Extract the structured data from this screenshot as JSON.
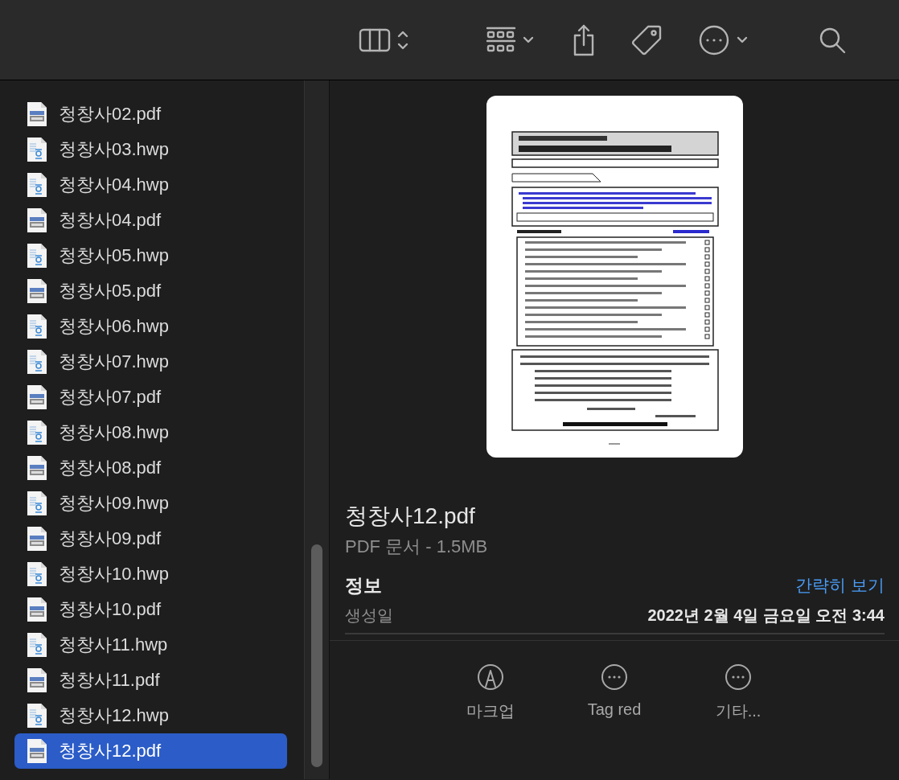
{
  "toolbar": {
    "items": [
      {
        "kind": "columns"
      },
      {
        "kind": "group"
      },
      {
        "kind": "share"
      },
      {
        "kind": "tag"
      },
      {
        "kind": "more"
      },
      {
        "kind": "search"
      }
    ]
  },
  "files": [
    {
      "name": "청창사02.pdf",
      "kind": "pdf",
      "selected": false
    },
    {
      "name": "청창사03.hwp",
      "kind": "hwp",
      "selected": false
    },
    {
      "name": "청창사04.hwp",
      "kind": "hwp",
      "selected": false
    },
    {
      "name": "청창사04.pdf",
      "kind": "pdf",
      "selected": false
    },
    {
      "name": "청창사05.hwp",
      "kind": "hwp",
      "selected": false
    },
    {
      "name": "청창사05.pdf",
      "kind": "pdf",
      "selected": false
    },
    {
      "name": "청창사06.hwp",
      "kind": "hwp",
      "selected": false
    },
    {
      "name": "청창사07.hwp",
      "kind": "hwp",
      "selected": false
    },
    {
      "name": "청창사07.pdf",
      "kind": "pdf",
      "selected": false
    },
    {
      "name": "청창사08.hwp",
      "kind": "hwp",
      "selected": false
    },
    {
      "name": "청창사08.pdf",
      "kind": "pdf",
      "selected": false
    },
    {
      "name": "청창사09.hwp",
      "kind": "hwp",
      "selected": false
    },
    {
      "name": "청창사09.pdf",
      "kind": "pdf",
      "selected": false
    },
    {
      "name": "청창사10.hwp",
      "kind": "hwp",
      "selected": false
    },
    {
      "name": "청창사10.pdf",
      "kind": "pdf",
      "selected": false
    },
    {
      "name": "청창사11.hwp",
      "kind": "hwp",
      "selected": false
    },
    {
      "name": "청창사11.pdf",
      "kind": "pdf",
      "selected": false
    },
    {
      "name": "청창사12.hwp",
      "kind": "hwp",
      "selected": false
    },
    {
      "name": "청창사12.pdf",
      "kind": "pdf",
      "selected": true
    }
  ],
  "preview": {
    "file_name": "청창사12.pdf",
    "subtitle": "PDF 문서 - 1.5MB",
    "info_heading": "정보",
    "info_toggle": "간략히 보기",
    "info_rows": [
      {
        "label": "생성일",
        "value": "2022년 2월 4일 금요일 오전 3:44"
      }
    ],
    "actions": [
      {
        "kind": "markup",
        "label": "마크업"
      },
      {
        "kind": "more",
        "label": "Tag red"
      },
      {
        "kind": "more",
        "label": "기타..."
      }
    ]
  }
}
